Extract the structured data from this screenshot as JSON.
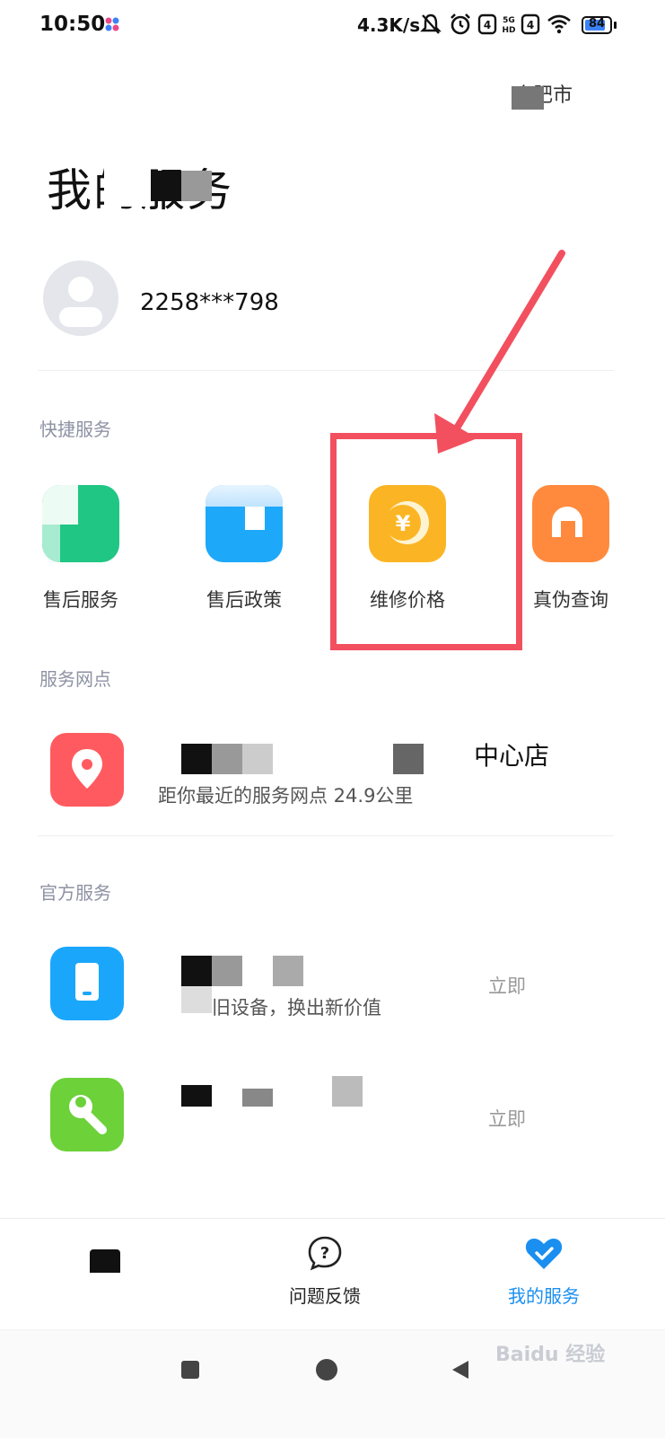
{
  "status_bar": {
    "time": "10:50",
    "net_speed": "4.3K/s",
    "battery": "84",
    "battery_level": 0.84,
    "icons": [
      "app-notification-icon",
      "mute-icon",
      "alarm-icon",
      "sim-4g-icon",
      "5g-hd-icon",
      "sim2-4g-icon",
      "wifi-icon",
      "battery-icon"
    ]
  },
  "header": {
    "location": "合肥市",
    "title": "我的服务"
  },
  "profile": {
    "username": "2258***798"
  },
  "quick_services": {
    "title": "快捷服务",
    "items": [
      {
        "label": "售后服务",
        "icon": "after-sales-icon",
        "color": "#20c684"
      },
      {
        "label": "售后政策",
        "icon": "policy-icon",
        "color": "#1da8fa"
      },
      {
        "label": "维修价格",
        "icon": "yen-coin-icon",
        "color": "#fbb524",
        "coin": "¥"
      },
      {
        "label": "真伪查询",
        "icon": "authenticity-icon",
        "color": "#ff8a3d"
      }
    ]
  },
  "service_points": {
    "title": "服务网点",
    "store_name_suffix": "中心店",
    "distance_text": "距你最近的服务网点 24.9公里",
    "icon_color": "#ff5a5f"
  },
  "official_services": {
    "title": "官方服务",
    "items": [
      {
        "subtitle": "旧设备，换出新价值",
        "action": "立即",
        "icon": "trade-in-icon",
        "color": "#1aa7fb"
      },
      {
        "subtitle": "",
        "action": "立即",
        "icon": "wrench-icon",
        "color": "#6dd13a"
      }
    ]
  },
  "tab_bar": {
    "tabs": [
      {
        "label": "",
        "icon": "home-icon"
      },
      {
        "label": "问题反馈",
        "icon": "question-bubble-icon"
      },
      {
        "label": "我的服务",
        "icon": "heart-check-icon",
        "active": true
      }
    ],
    "active_color": "#1a8ff0"
  },
  "watermark": "Baidu 经验"
}
